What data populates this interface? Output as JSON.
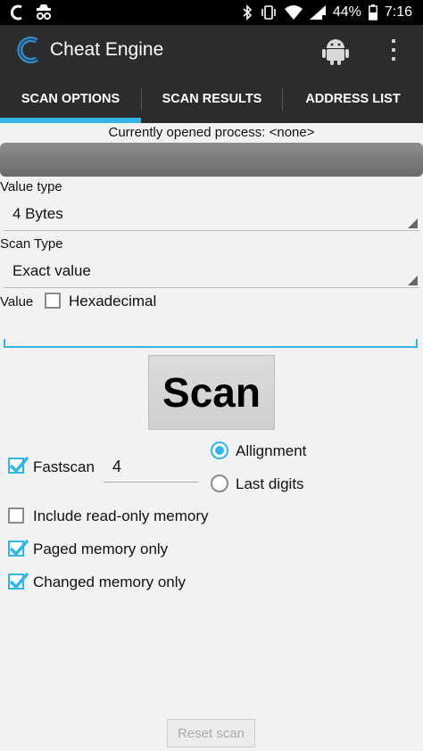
{
  "status_bar": {
    "battery": "44%",
    "time": "7:16"
  },
  "app": {
    "title": "Cheat Engine"
  },
  "tabs": [
    {
      "label": "SCAN OPTIONS"
    },
    {
      "label": "SCAN RESULTS"
    },
    {
      "label": "ADDRESS LIST"
    }
  ],
  "process_text": "Currently opened process: <none>",
  "value_type": {
    "label": "Value type",
    "selected": "4 Bytes"
  },
  "scan_type": {
    "label": "Scan Type",
    "selected": "Exact value"
  },
  "value": {
    "label": "Value",
    "hex_label": "Hexadecimal",
    "hex_checked": false,
    "input": ""
  },
  "scan_button": "Scan",
  "fastscan": {
    "label": "Fastscan",
    "checked": true,
    "value": "4"
  },
  "alignment": {
    "allignment_label": "Allignment",
    "last_digits_label": "Last digits",
    "selected": "Allignment"
  },
  "options": {
    "include_readonly": {
      "label": "Include read-only memory",
      "checked": false
    },
    "paged_only": {
      "label": "Paged memory only",
      "checked": true
    },
    "changed_only": {
      "label": "Changed memory only",
      "checked": true
    }
  },
  "reset_button": "Reset scan",
  "colors": {
    "accent": "#33b5e5",
    "appbar": "#2a2c2e"
  }
}
